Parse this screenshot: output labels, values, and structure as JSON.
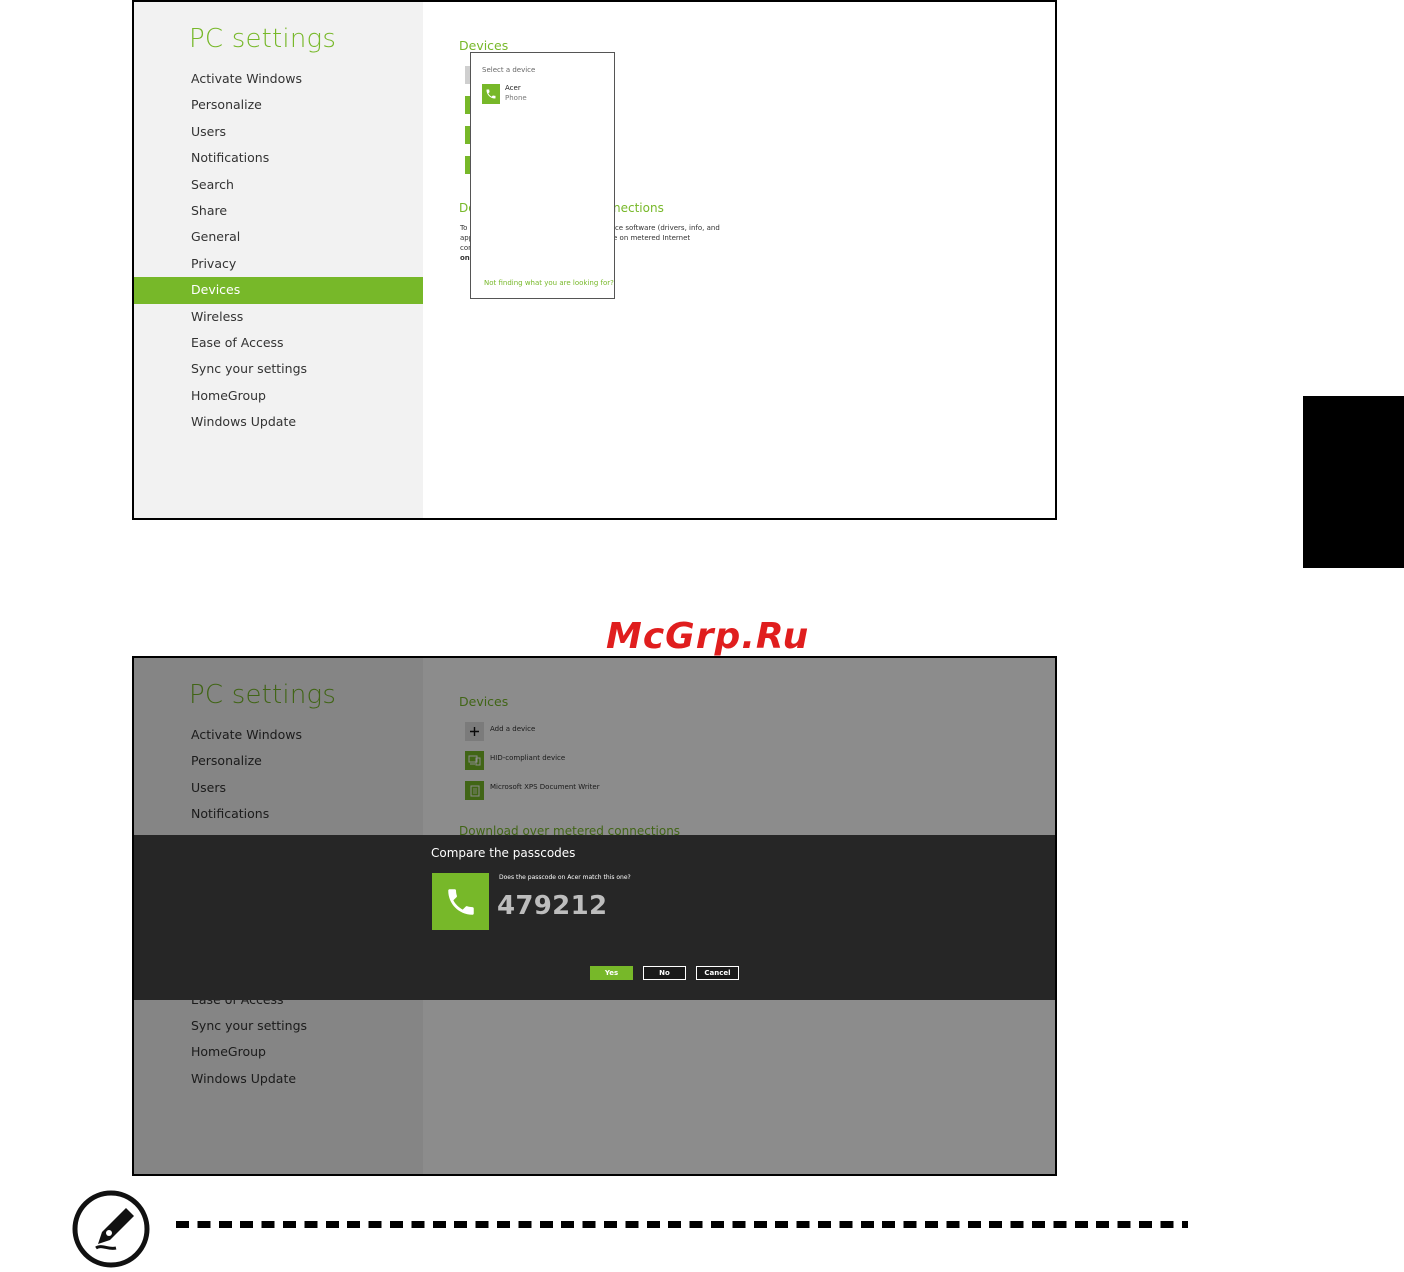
{
  "pc_settings": {
    "title": "PC settings",
    "nav": [
      "Activate Windows",
      "Personalize",
      "Users",
      "Notifications",
      "Search",
      "Share",
      "General",
      "Privacy",
      "Devices",
      "Wireless",
      "Ease of Access",
      "Sync your settings",
      "HomeGroup",
      "Windows Update"
    ],
    "active": "Devices"
  },
  "screen1": {
    "section_title": "Devices",
    "download_heading_left": "Do",
    "download_heading_right": "nections",
    "partial_line1_left": "To",
    "partial_line2_left": "app",
    "partial_line3_left": "con",
    "partial_line4_left": "on",
    "partial_line1_right": "ice software (drivers, info, and",
    "partial_line2_right": "e on metered Internet",
    "popup": {
      "header": "Select a device",
      "device_name": "Acer",
      "device_type": "Phone",
      "not_finding": "Not finding what you are looking for?"
    }
  },
  "screen2": {
    "section_title": "Devices",
    "devices": [
      {
        "label": "Add a device",
        "icon": "plus-icon"
      },
      {
        "label": "HID-compliant device",
        "icon": "hid-device-icon"
      },
      {
        "label": "Microsoft XPS Document Writer",
        "icon": "printer-icon"
      }
    ],
    "download_heading": "Download over metered connections",
    "nav_visible_top": [
      "Activate Windows",
      "Personalize",
      "Users",
      "Notifications"
    ],
    "nav_visible_bottom": [
      "Ease of Access",
      "Sync your settings",
      "HomeGroup",
      "Windows Update"
    ],
    "dialog": {
      "title": "Compare the passcodes",
      "question": "Does the passcode on Acer match this one?",
      "passcode": "479212",
      "yes": "Yes",
      "no": "No",
      "cancel": "Cancel"
    }
  },
  "watermark": "McGrp.Ru",
  "colors": {
    "accent": "#77b829",
    "dialog_bg": "#262626",
    "sidebar_bg": "#f2f2f2"
  }
}
